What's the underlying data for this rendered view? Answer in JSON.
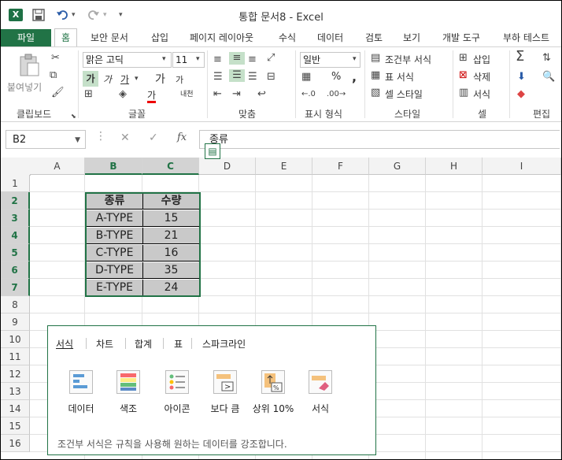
{
  "window": {
    "title": "통합 문서8 - Excel",
    "app_badge": "X"
  },
  "quick_access": {
    "save_icon": "save-icon",
    "undo_icon": "undo-icon",
    "redo_icon": "redo-icon",
    "customize_icon": "customize-icon"
  },
  "tabs": [
    {
      "label": "파일"
    },
    {
      "label": "홈"
    },
    {
      "label": "보안 문서"
    },
    {
      "label": "삽입"
    },
    {
      "label": "페이지 레이아웃"
    },
    {
      "label": "수식"
    },
    {
      "label": "데이터"
    },
    {
      "label": "검토"
    },
    {
      "label": "보기"
    },
    {
      "label": "개발 도구"
    },
    {
      "label": "부하 테스트"
    }
  ],
  "ribbon": {
    "clipboard": {
      "label": "클립보드",
      "paste": "붙여넣기"
    },
    "font": {
      "label": "글꼴",
      "font_name": "맑은 고딕",
      "font_size": "11",
      "bold": "가",
      "italic": "가",
      "underline": "가",
      "grow": "가",
      "shrink": "가",
      "phonetic": "내천",
      "fontcolor_glyph": "가"
    },
    "alignment": {
      "label": "맞춤"
    },
    "number": {
      "label": "표시 형식",
      "format": "일반",
      "percent": "%",
      "comma": ","
    },
    "styles": {
      "label": "스타일",
      "conditional": "조건부 서식",
      "table": "표 서식",
      "cell_style": "셀 스타일"
    },
    "cells": {
      "label": "셀",
      "insert": "삽입",
      "delete": "삭제",
      "format": "서식"
    },
    "editing": {
      "label": "편집"
    }
  },
  "formula_bar": {
    "name_box": "B2",
    "formula": "종류"
  },
  "grid": {
    "columns": [
      "A",
      "B",
      "C",
      "D",
      "E",
      "F",
      "G",
      "H",
      "I"
    ],
    "rows": [
      "1",
      "2",
      "3",
      "4",
      "5",
      "6",
      "7",
      "8",
      "9",
      "10",
      "11",
      "12",
      "13",
      "14",
      "15",
      "16"
    ],
    "table": {
      "headers": [
        "종류",
        "수량"
      ],
      "rows": [
        [
          "A-TYPE",
          "15"
        ],
        [
          "B-TYPE",
          "21"
        ],
        [
          "C-TYPE",
          "16"
        ],
        [
          "D-TYPE",
          "35"
        ],
        [
          "E-TYPE",
          "24"
        ]
      ]
    }
  },
  "quick_analysis": {
    "tabs": [
      "서식",
      "차트",
      "합계",
      "표",
      "스파크라인"
    ],
    "items": [
      "데이터",
      "색조",
      "아이콘",
      "보다 큼",
      "상위 10%",
      "서식"
    ],
    "description": "조건부 서식은 규칙을 사용해 원하는 데이터를 강조합니다."
  },
  "colors": {
    "accent": "#217346",
    "cell_fill": "#c9c9c9"
  }
}
